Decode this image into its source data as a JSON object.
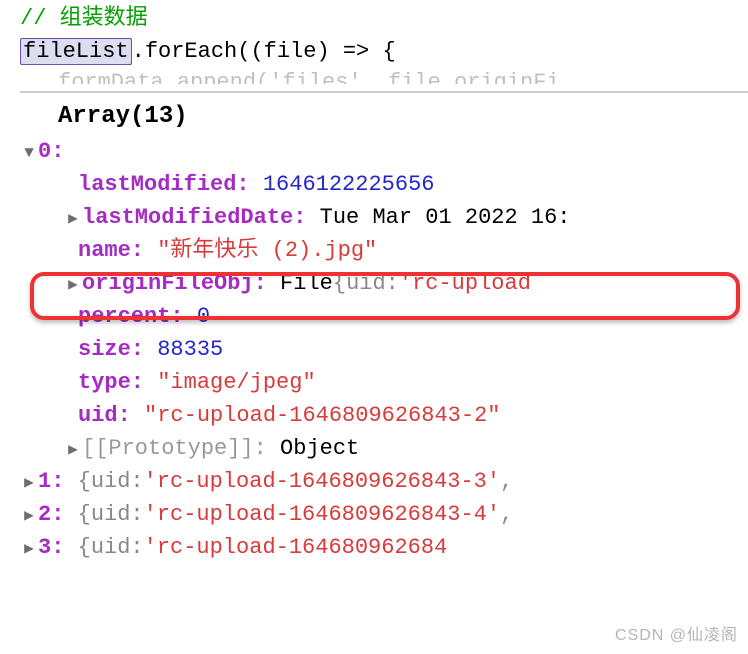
{
  "code": {
    "comment": "// 组装数据",
    "line1_var": "fileList",
    "line1_rest": ".forEach((file) => {",
    "faded": "formData.append('files', file.originFi"
  },
  "console": {
    "array_header": "Array(13)",
    "item0_index": "0:",
    "props": {
      "lastModified": {
        "key": "lastModified:",
        "value": "1646122225656"
      },
      "lastModifiedDate": {
        "key": "lastModifiedDate:",
        "value": "Tue Mar 01 2022 16:"
      },
      "name": {
        "key": "name:",
        "value": "\"新年快乐 (2).jpg\""
      },
      "originFileObj": {
        "key": "originFileObj:",
        "type": "File ",
        "preview_open": "{",
        "preview_key": "uid: ",
        "preview_val": "'rc-upload"
      },
      "percent": {
        "key": "percent:",
        "value": "0"
      },
      "size": {
        "key": "size:",
        "value": "88335"
      },
      "type": {
        "key": "type:",
        "value": "\"image/jpeg\""
      },
      "uid": {
        "key": "uid:",
        "value": "\"rc-upload-1646809626843-2\""
      },
      "prototype": {
        "key": "[[Prototype]]:",
        "value": "Object"
      }
    },
    "collapsed_items": {
      "i1": {
        "key": "1:",
        "open": "{",
        "pkey": "uid: ",
        "pval": "'rc-upload-1646809626843-3'",
        "comma": ","
      },
      "i2": {
        "key": "2:",
        "open": "{",
        "pkey": "uid: ",
        "pval": "'rc-upload-1646809626843-4'",
        "comma": ","
      },
      "i3": {
        "key": "3:",
        "open": "{",
        "pkey": "uid: ",
        "pval": "'rc-upload-164680962684"
      }
    }
  },
  "watermark": "CSDN @仙凌阁"
}
